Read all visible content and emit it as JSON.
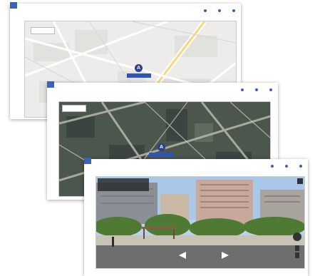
{
  "cards": [
    {
      "tab_label": "",
      "links": [
        "",
        "",
        ""
      ],
      "below_link": ""
    },
    {
      "tab_label": "",
      "links": [
        "",
        "",
        ""
      ],
      "below_link": ""
    },
    {
      "tab_label": "",
      "links": [
        "",
        "",
        ""
      ],
      "below_link": ""
    }
  ],
  "maps": {
    "schematic": {
      "marker_glyph": "A",
      "map_type_buttons": [
        "",
        ""
      ]
    },
    "satellite": {
      "marker_glyph": "A",
      "map_type_buttons": [
        "",
        ""
      ]
    },
    "street": {
      "info_title": "",
      "info_subtitle": ""
    }
  },
  "icons": [
    "link-icon",
    "map-marker-icon",
    "compass-icon",
    "zoom-in-icon",
    "zoom-out-icon"
  ],
  "colors": {
    "accent": "#3c63b7",
    "marker": "#2a3f8f",
    "map_bg": "#eeecea"
  }
}
